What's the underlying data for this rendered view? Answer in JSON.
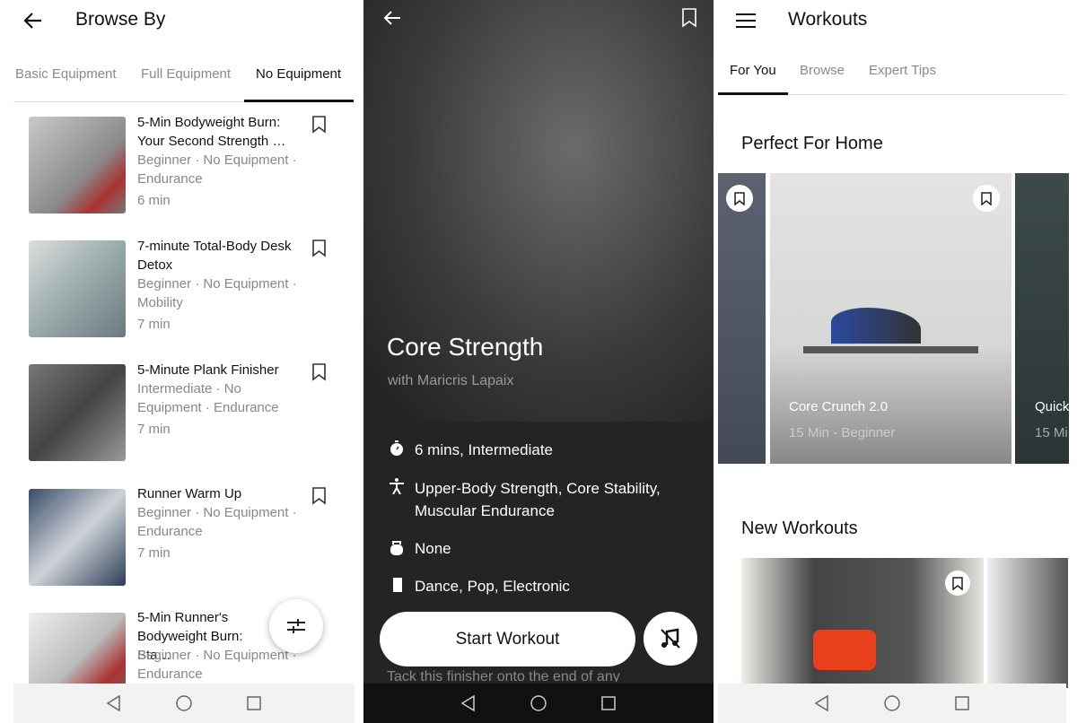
{
  "browse": {
    "title": "Browse By",
    "tabs": [
      {
        "label": "Basic Equipment"
      },
      {
        "label": "Full Equipment"
      },
      {
        "label": "No Equipment",
        "active": true
      }
    ],
    "items": [
      {
        "title": "5-Min Bodyweight Burn: Your Second Strength …",
        "meta": "Beginner · No Equipment · Endurance",
        "duration": "6 min"
      },
      {
        "title": "7-minute Total-Body Desk Detox",
        "meta": "Beginner · No Equipment · Mobility",
        "duration": "7 min"
      },
      {
        "title": "5-Minute Plank Finisher",
        "meta": "Intermediate · No Equipment · Endurance",
        "duration": "7 min"
      },
      {
        "title": "Runner Warm Up",
        "meta": "Beginner · No Equipment · Endurance",
        "duration": "7 min"
      },
      {
        "title": "5-Min Runner's Bodyweight Burn: Sta…",
        "meta": "Beginner · No Equipment · Endurance",
        "duration": ""
      }
    ]
  },
  "detail": {
    "title": "Core Strength",
    "subtitle": "with Maricris Lapaix",
    "rows": [
      {
        "icon": "stopwatch-icon",
        "text": "6 mins, Intermediate"
      },
      {
        "icon": "figure-icon",
        "text": "Upper-Body Strength, Core Stability, Muscular Endurance"
      },
      {
        "icon": "kettlebell-icon",
        "text": "None"
      },
      {
        "icon": "music-icon",
        "text": "Dance, Pop, Electronic"
      }
    ],
    "start_label": "Start Workout",
    "description": "Tack this finisher onto the end of any"
  },
  "workouts": {
    "title": "Workouts",
    "tabs": [
      {
        "label": "For You",
        "active": true
      },
      {
        "label": "Browse"
      },
      {
        "label": "Expert Tips"
      }
    ],
    "section1": "Perfect For Home",
    "cards": [
      {
        "title": "Core Crunch 2.0",
        "meta": "15 Min - Beginner"
      },
      {
        "title": "Quick",
        "meta": "15 Mi"
      }
    ],
    "section2": "New Workouts"
  },
  "colors": {
    "dark_bg": "#242424",
    "accent": "#111111"
  }
}
